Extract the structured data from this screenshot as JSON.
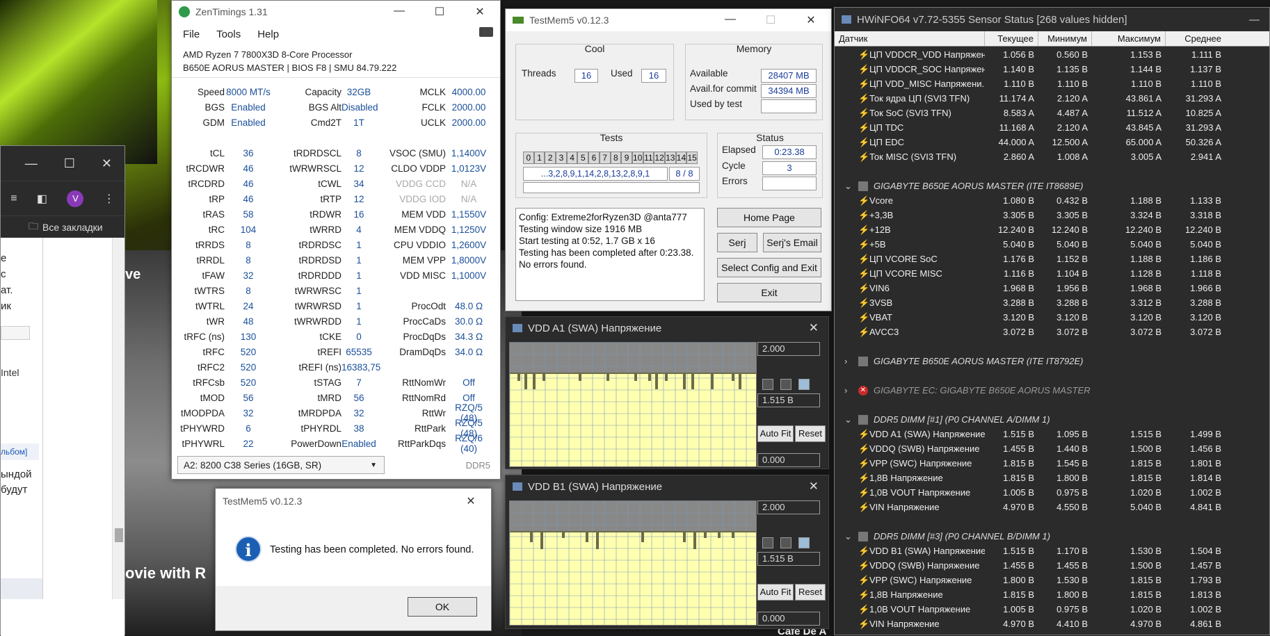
{
  "colors": {
    "accent": "#1a4f9a",
    "warning_bolt": "#f4c01b",
    "error_red": "#c92a2a",
    "plot_bg": "#ffffb0"
  },
  "video": {
    "title": "ovie with R",
    "side_title": "ve",
    "bottom_right": "Cafe De A"
  },
  "browser": {
    "avatar_letter": "V",
    "bookmarks_label": "Все закладки",
    "text_lines": [
      "е",
      "с",
      "ат.",
      "ик"
    ],
    "intel": "Intel",
    "album_link": "льбом]",
    "bottom_lines": [
      "ындой",
      "будут"
    ]
  },
  "zen": {
    "title": "ZenTimings 1.31",
    "menu": [
      "File",
      "Tools",
      "Help"
    ],
    "cpu": "AMD Ryzen 7 7800X3D 8-Core Processor",
    "board": "B650E AORUS MASTER | BIOS F8 | SMU 84.79.222",
    "rows": [
      [
        "Speed",
        "8000 MT/s",
        "Capacity",
        "32GB",
        "MCLK",
        "4000.00"
      ],
      [
        "BGS",
        "Enabled",
        "BGS Alt",
        "Disabled",
        "FCLK",
        "2000.00"
      ],
      [
        "GDM",
        "Enabled",
        "Cmd2T",
        "1T",
        "UCLK",
        "2000.00"
      ],
      [
        "",
        "",
        "",
        "",
        "",
        ""
      ],
      [
        "tCL",
        "36",
        "tRDRDSCL",
        "8",
        "VSOC (SMU)",
        "1,1400V"
      ],
      [
        "tRCDWR",
        "46",
        "tWRWRSCL",
        "12",
        "CLDO VDDP",
        "1,0123V"
      ],
      [
        "tRCDRD",
        "46",
        "tCWL",
        "34",
        "VDDG CCD",
        "N/A"
      ],
      [
        "tRP",
        "46",
        "tRTP",
        "12",
        "VDDG IOD",
        "N/A"
      ],
      [
        "tRAS",
        "58",
        "tRDWR",
        "16",
        "MEM VDD",
        "1,1550V"
      ],
      [
        "tRC",
        "104",
        "tWRRD",
        "4",
        "MEM VDDQ",
        "1,1250V"
      ],
      [
        "tRRDS",
        "8",
        "tRDRDSC",
        "1",
        "CPU VDDIO",
        "1,2600V"
      ],
      [
        "tRRDL",
        "8",
        "tRDRDSD",
        "1",
        "MEM VPP",
        "1,8000V"
      ],
      [
        "tFAW",
        "32",
        "tRDRDDD",
        "1",
        "VDD MISC",
        "1,1000V"
      ],
      [
        "tWTRS",
        "8",
        "tWRWRSC",
        "1",
        "",
        ""
      ],
      [
        "tWTRL",
        "24",
        "tWRWRSD",
        "1",
        "ProcOdt",
        "48.0 Ω"
      ],
      [
        "tWR",
        "48",
        "tWRWRDD",
        "1",
        "ProcCaDs",
        "30.0 Ω"
      ],
      [
        "tRFC (ns)",
        "130",
        "tCKE",
        "0",
        "ProcDqDs",
        "34.3 Ω"
      ],
      [
        "tRFC",
        "520",
        "tREFI",
        "65535",
        "DramDqDs",
        "34.0 Ω"
      ],
      [
        "tRFC2",
        "520",
        "tREFI (ns)",
        "16383,75",
        "",
        ""
      ],
      [
        "tRFCsb",
        "520",
        "tSTAG",
        "7",
        "RttNomWr",
        "Off"
      ],
      [
        "tMOD",
        "56",
        "tMRD",
        "56",
        "RttNomRd",
        "Off"
      ],
      [
        "tMODPDA",
        "32",
        "tMRDPDA",
        "32",
        "RttWr",
        "RZQ/5 (48)"
      ],
      [
        "tPHYWRD",
        "6",
        "tPHYRDL",
        "38",
        "RttPark",
        "RZQ/5 (48)"
      ],
      [
        "tPHYWRL",
        "22",
        "PowerDown",
        "Enabled",
        "RttParkDqs",
        "RZQ/6 (40)"
      ]
    ],
    "profile": "A2: 8200 C38 Series (16GB, SR)",
    "mem_type": "DDR5"
  },
  "tm": {
    "title": "TestMem5 v0.12.3",
    "cool": {
      "label": "Cool",
      "threads_label": "Threads",
      "threads": "16",
      "used_label": "Used",
      "used": "16"
    },
    "memory": {
      "label": "Memory",
      "available_label": "Available",
      "available": "28407 MB",
      "commit_label": "Avail.for commit",
      "commit": "34394 MB",
      "used_by_test_label": "Used by test",
      "used_by_test": ""
    },
    "tests": {
      "label": "Tests",
      "cells": [
        "0",
        "1",
        "2",
        "3",
        "4",
        "5",
        "6",
        "7",
        "8",
        "9",
        "10",
        "11",
        "12",
        "13",
        "14",
        "15"
      ],
      "sequence": "...3,2,8,9,1,14,2,8,13,2,8,9,1",
      "progress": "8 / 8"
    },
    "status": {
      "label": "Status",
      "elapsed_label": "Elapsed",
      "elapsed": "0:23.38",
      "cycle_label": "Cycle",
      "cycle": "3",
      "errors_label": "Errors",
      "errors": ""
    },
    "log": [
      "Config: Extreme2forRyzen3D @anta777",
      "Testing window size 1916 MB",
      "Start testing at 0:52, 1.7 GB x 16",
      "Testing has been completed after 0:23.38.",
      "No errors found."
    ],
    "buttons": {
      "home": "Home Page",
      "serj": "Serj",
      "serj_email": "Serj's Email",
      "select": "Select Config and Exit",
      "exit": "Exit"
    }
  },
  "graph1": {
    "title": "VDD A1 (SWA) Напряжение",
    "max": "2.000",
    "cur": "1.515 В",
    "min": "0.000",
    "autofit": "Auto Fit",
    "reset": "Reset"
  },
  "graph2": {
    "title": "VDD B1 (SWA) Напряжение",
    "max": "2.000",
    "cur": "1.515 В",
    "min": "0.000",
    "autofit": "Auto Fit",
    "reset": "Reset"
  },
  "dialog": {
    "title": "TestMem5 v0.12.3",
    "message": "Testing has been completed. No errors found.",
    "ok": "OK"
  },
  "hw": {
    "title": "HWiNFO64 v7.72-5355 Sensor Status [268 values hidden]",
    "headers": [
      "Датчик",
      "Текущее",
      "Минимум",
      "Максимум",
      "Среднее"
    ],
    "group1": [
      [
        "ЦП VDDCR_VDD Напряжен...",
        "1.056 В",
        "0.560 В",
        "1.153 В",
        "1.111 В"
      ],
      [
        "ЦП VDDCR_SOC Напряжен...",
        "1.140 В",
        "1.135 В",
        "1.144 В",
        "1.137 В"
      ],
      [
        "ЦП VDD_MISC Напряжени...",
        "1.110 В",
        "1.110 В",
        "1.110 В",
        "1.110 В"
      ],
      [
        "Ток ядра ЦП (SVI3 TFN)",
        "11.174 A",
        "2.120 A",
        "43.861 A",
        "31.293 A"
      ],
      [
        "Ток SoC (SVI3 TFN)",
        "8.583 A",
        "4.487 A",
        "11.512 A",
        "10.825 A"
      ],
      [
        "ЦП TDC",
        "11.168 A",
        "2.120 A",
        "43.845 A",
        "31.293 A"
      ],
      [
        "ЦП EDC",
        "44.000 A",
        "12.500 A",
        "65.000 A",
        "50.326 A"
      ],
      [
        "Ток MISC (SVI3 TFN)",
        "2.860 A",
        "1.008 A",
        "3.005 A",
        "2.941 A"
      ]
    ],
    "sec_ite1": "GIGABYTE B650E AORUS MASTER (ITE IT8689E)",
    "group2": [
      [
        "Vcore",
        "1.080 В",
        "0.432 В",
        "1.188 В",
        "1.133 В"
      ],
      [
        "+3,3В",
        "3.305 В",
        "3.305 В",
        "3.324 В",
        "3.318 В"
      ],
      [
        "+12В",
        "12.240 В",
        "12.240 В",
        "12.240 В",
        "12.240 В"
      ],
      [
        "+5В",
        "5.040 В",
        "5.040 В",
        "5.040 В",
        "5.040 В"
      ],
      [
        "ЦП VCORE SoC",
        "1.176 В",
        "1.152 В",
        "1.188 В",
        "1.186 В"
      ],
      [
        "ЦП VCORE MISC",
        "1.116 В",
        "1.104 В",
        "1.128 В",
        "1.118 В"
      ],
      [
        "VIN6",
        "1.968 В",
        "1.956 В",
        "1.968 В",
        "1.966 В"
      ],
      [
        "3VSB",
        "3.288 В",
        "3.288 В",
        "3.312 В",
        "3.288 В"
      ],
      [
        "VBAT",
        "3.120 В",
        "3.120 В",
        "3.120 В",
        "3.120 В"
      ],
      [
        "AVCC3",
        "3.072 В",
        "3.072 В",
        "3.072 В",
        "3.072 В"
      ]
    ],
    "sec_ite2": "GIGABYTE B650E AORUS MASTER (ITE IT8792E)",
    "sec_ec": "GIGABYTE EC: GIGABYTE B650E AORUS MASTER",
    "sec_dimm1": "DDR5 DIMM [#1] (P0 CHANNEL A/DIMM 1)",
    "group3": [
      [
        "VDD A1 (SWA) Напряжение",
        "1.515 В",
        "1.095 В",
        "1.515 В",
        "1.499 В"
      ],
      [
        "VDDQ (SWB) Напряжение",
        "1.455 В",
        "1.440 В",
        "1.500 В",
        "1.456 В"
      ],
      [
        "VPP (SWC) Напряжение",
        "1.815 В",
        "1.545 В",
        "1.815 В",
        "1.801 В"
      ],
      [
        "1,8В Напряжение",
        "1.815 В",
        "1.800 В",
        "1.815 В",
        "1.814 В"
      ],
      [
        "1,0В VOUT Напряжение",
        "1.005 В",
        "0.975 В",
        "1.020 В",
        "1.002 В"
      ],
      [
        "VIN Напряжение",
        "4.970 В",
        "4.550 В",
        "5.040 В",
        "4.841 В"
      ]
    ],
    "sec_dimm3": "DDR5 DIMM [#3] (P0 CHANNEL B/DIMM 1)",
    "group4": [
      [
        "VDD B1 (SWA) Напряжение",
        "1.515 В",
        "1.170 В",
        "1.530 В",
        "1.504 В"
      ],
      [
        "VDDQ (SWB) Напряжение",
        "1.455 В",
        "1.455 В",
        "1.500 В",
        "1.457 В"
      ],
      [
        "VPP (SWC) Напряжение",
        "1.800 В",
        "1.530 В",
        "1.815 В",
        "1.793 В"
      ],
      [
        "1,8В Напряжение",
        "1.815 В",
        "1.800 В",
        "1.815 В",
        "1.813 В"
      ],
      [
        "1,0В VOUT Напряжение",
        "1.005 В",
        "0.975 В",
        "1.020 В",
        "1.002 В"
      ],
      [
        "VIN Напряжение",
        "4.970 В",
        "4.410 В",
        "4.970 В",
        "4.861 В"
      ]
    ]
  }
}
